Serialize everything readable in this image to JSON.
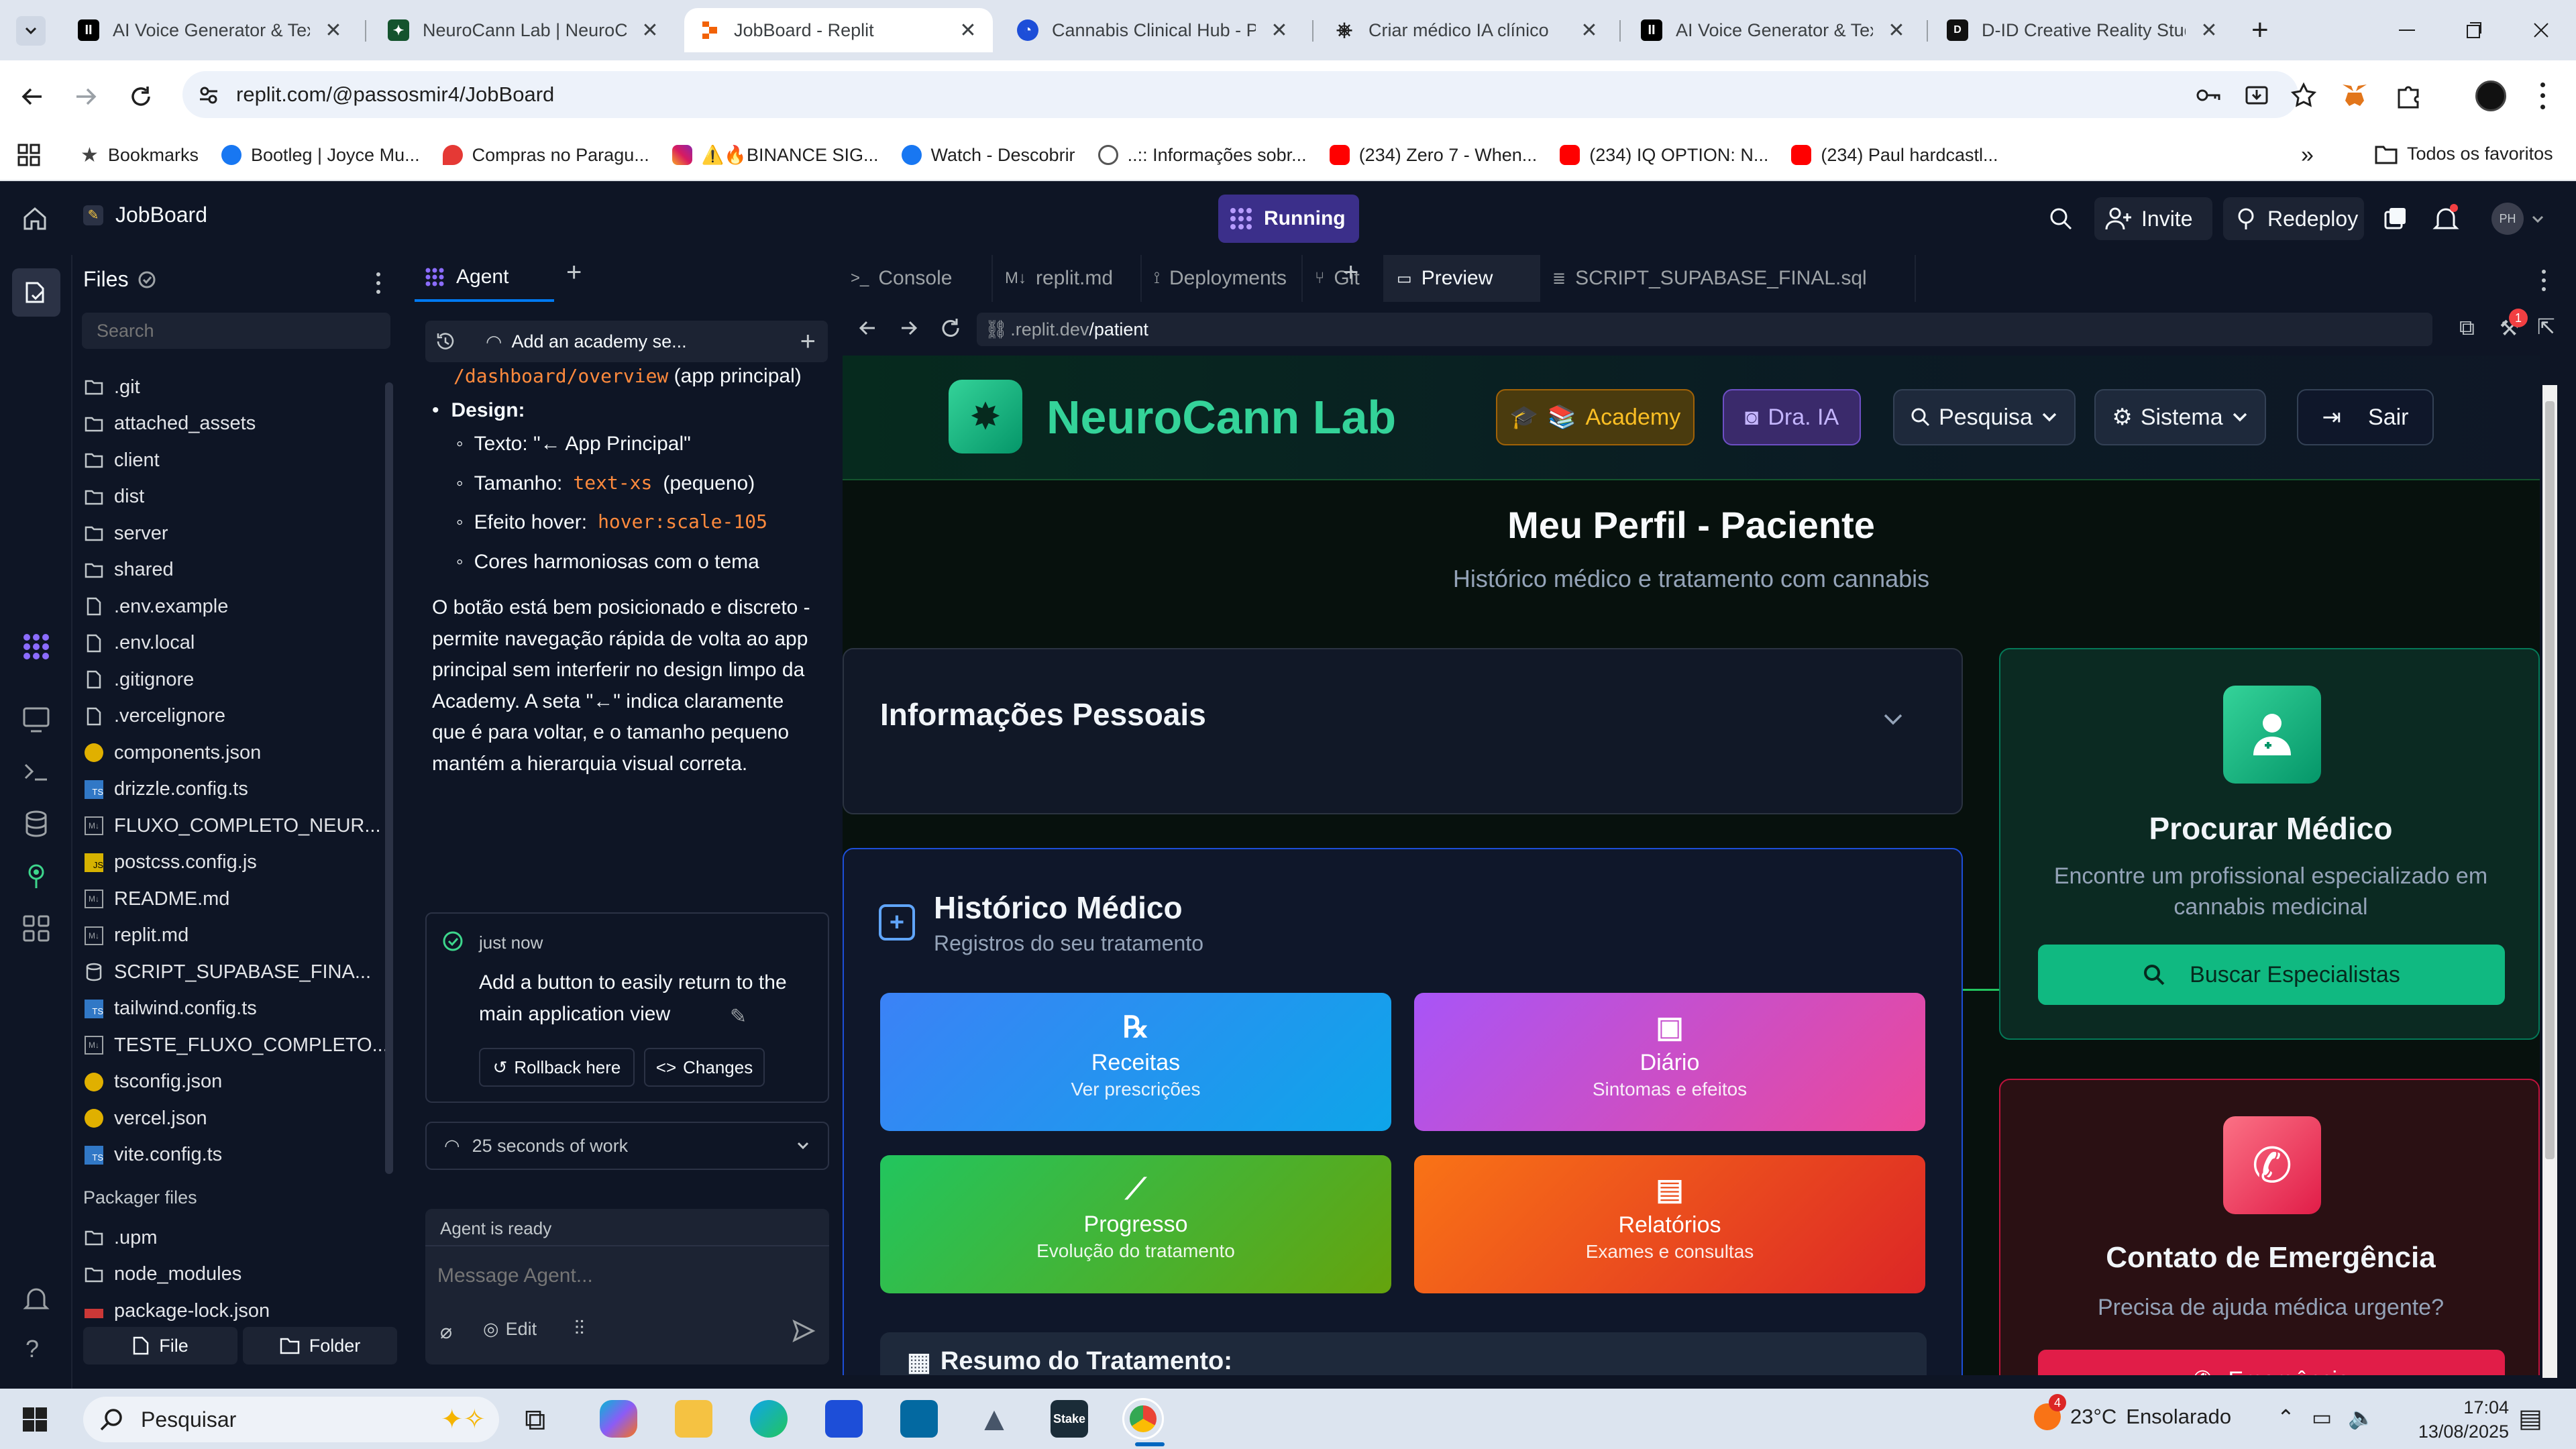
{
  "browser": {
    "tabs": [
      {
        "label": "AI Voice Generator & Text",
        "icon": "elevenlabs-icon"
      },
      {
        "label": "NeuroCann Lab | NeuroCann",
        "icon": "neurocann-icon"
      },
      {
        "label": "JobBoard - Replit",
        "icon": "replit-icon"
      },
      {
        "label": "Cannabis Clinical Hub - Pl",
        "icon": "clinical-hub-icon"
      },
      {
        "label": "Criar médico IA clínico",
        "icon": "chatgpt-icon"
      },
      {
        "label": "AI Voice Generator & Text",
        "icon": "elevenlabs-icon"
      },
      {
        "label": "D-ID Creative Reality Stud",
        "icon": "did-icon"
      }
    ],
    "url": "replit.com/@passosmir4/JobBoard",
    "bookmarks": [
      {
        "label": "Bookmarks",
        "icon": "star-icon"
      },
      {
        "label": "Bootleg | Joyce Mu...",
        "icon": "facebook-icon"
      },
      {
        "label": "Compras no Paragu...",
        "icon": "pin-icon"
      },
      {
        "label": "⚠️🔥BINANCE SIG...",
        "icon": "instagram-icon"
      },
      {
        "label": "Watch - Descobrir",
        "icon": "facebook-icon"
      },
      {
        "label": "..:: Informações sobr...",
        "icon": "globe-icon"
      },
      {
        "label": "(234) Zero 7 - When...",
        "icon": "youtube-icon"
      },
      {
        "label": "(234) IQ OPTION: N...",
        "icon": "youtube-icon"
      },
      {
        "label": "(234) Paul hardcastl...",
        "icon": "youtube-icon"
      }
    ],
    "all_bookmarks": "Todos os favoritos"
  },
  "replit": {
    "project": "JobBoard",
    "status": "Running",
    "invite": "Invite",
    "redeploy": "Redeploy",
    "avatar": "PH",
    "files_title": "Files",
    "search_placeholder": "Search",
    "files": [
      {
        "name": ".git",
        "type": "folder"
      },
      {
        "name": "attached_assets",
        "type": "folder"
      },
      {
        "name": "client",
        "type": "folder"
      },
      {
        "name": "dist",
        "type": "folder"
      },
      {
        "name": "server",
        "type": "folder"
      },
      {
        "name": "shared",
        "type": "folder"
      },
      {
        "name": ".env.example",
        "type": "file"
      },
      {
        "name": ".env.local",
        "type": "file"
      },
      {
        "name": ".gitignore",
        "type": "file"
      },
      {
        "name": ".vercelignore",
        "type": "file"
      },
      {
        "name": "components.json",
        "type": "json"
      },
      {
        "name": "drizzle.config.ts",
        "type": "ts"
      },
      {
        "name": "FLUXO_COMPLETO_NEUR...",
        "type": "md"
      },
      {
        "name": "postcss.config.js",
        "type": "js"
      },
      {
        "name": "README.md",
        "type": "md"
      },
      {
        "name": "replit.md",
        "type": "md"
      },
      {
        "name": "SCRIPT_SUPABASE_FINA...",
        "type": "db"
      },
      {
        "name": "tailwind.config.ts",
        "type": "ts"
      },
      {
        "name": "TESTE_FLUXO_COMPLETO...",
        "type": "md"
      },
      {
        "name": "tsconfig.json",
        "type": "json"
      },
      {
        "name": "vercel.json",
        "type": "json"
      },
      {
        "name": "vite.config.ts",
        "type": "ts"
      }
    ],
    "packager_title": "Packager files",
    "packager_files": [
      {
        "name": ".upm",
        "type": "folder"
      },
      {
        "name": "node_modules",
        "type": "folder"
      },
      {
        "name": "package-lock.json",
        "type": "npm"
      }
    ],
    "add_file": "File",
    "add_folder": "Folder",
    "agent": {
      "tab": "Agent",
      "thread_title": "Add an academy se...",
      "route": "/dashboard/overview",
      "route_suffix": "(app principal)",
      "design_label": "Design:",
      "items": [
        {
          "label": "Texto: \"← App Principal\"",
          "code": ""
        },
        {
          "label": "Tamanho:",
          "code": "text-xs",
          "after": "(pequeno)"
        },
        {
          "label": "Efeito hover:",
          "code": "hover:scale-105",
          "after": ""
        },
        {
          "label": "Cores harmoniosas com o tema",
          "code": ""
        }
      ],
      "paragraph": "O botão está bem posicionado e discreto - permite navegação rápida de volta ao app principal sem interferir no design limpo da Academy. A seta \"←\" indica claramente que é para voltar, e o tamanho pequeno mantém a hierarquia visual correta.",
      "checkpoint_time": "just now",
      "checkpoint_text": "Add a button to easily return to the main application view",
      "rollback": "Rollback here",
      "changes": "Changes",
      "work_time": "25 seconds of work",
      "status": "Agent is ready",
      "input_placeholder": "Message Agent...",
      "edit": "Edit"
    },
    "tabs": [
      {
        "label": "Console"
      },
      {
        "label": "replit.md"
      },
      {
        "label": "Deployments"
      },
      {
        "label": "Git"
      },
      {
        "label": "Preview"
      },
      {
        "label": "SCRIPT_SUPABASE_FINAL.sql"
      }
    ],
    "preview_url_prefix": ".replit.dev",
    "preview_url_path": "/patient",
    "notification_count": "1"
  },
  "app": {
    "brand": "NeuroCann Lab",
    "nav": {
      "academy": "Academy",
      "dra_ia": "Dra. IA",
      "pesquisa": "Pesquisa",
      "sistema": "Sistema",
      "sair": "Sair"
    },
    "page_title": "Meu Perfil - Paciente",
    "page_subtitle": "Histórico médico e tratamento com cannabis",
    "personal_info": "Informações Pessoais",
    "history_title": "Histórico Médico",
    "history_subtitle": "Registros do seu tratamento",
    "tiles": [
      {
        "title": "Receitas",
        "subtitle": "Ver prescrições",
        "icon": "prescription-icon",
        "from": "#3b82f6",
        "to": "#0ea5e9"
      },
      {
        "title": "Diário",
        "subtitle": "Sintomas e efeitos",
        "icon": "calendar-check-icon",
        "from": "#a855f7",
        "to": "#ec4899"
      },
      {
        "title": "Progresso",
        "subtitle": "Evolução do tratamento",
        "icon": "chart-line-icon",
        "from": "#22c55e",
        "to": "#65a30d"
      },
      {
        "title": "Relatórios",
        "subtitle": "Exames e consultas",
        "icon": "file-medical-icon",
        "from": "#f97316",
        "to": "#dc2626"
      }
    ],
    "summary_partial": "Resumo do Tratamento:",
    "find_doctor": {
      "title": "Procurar Médico",
      "text": "Encontre um profissional especializado em cannabis medicinal",
      "button": "Buscar Especialistas"
    },
    "emergency": {
      "title": "Contato de Emergência",
      "text": "Precisa de ajuda médica urgente?",
      "button": "Emergência"
    }
  },
  "taskbar": {
    "search": "Pesquisar",
    "weather_temp": "23°C",
    "weather_text": "Ensolarado",
    "weather_badge": "4",
    "time": "17:04",
    "date": "13/08/2025"
  },
  "colors": {
    "replit_bg": "#0e1525",
    "accent_green": "#10b981",
    "running_purple": "#6e3ff3",
    "emergency_red": "#e11d48"
  }
}
